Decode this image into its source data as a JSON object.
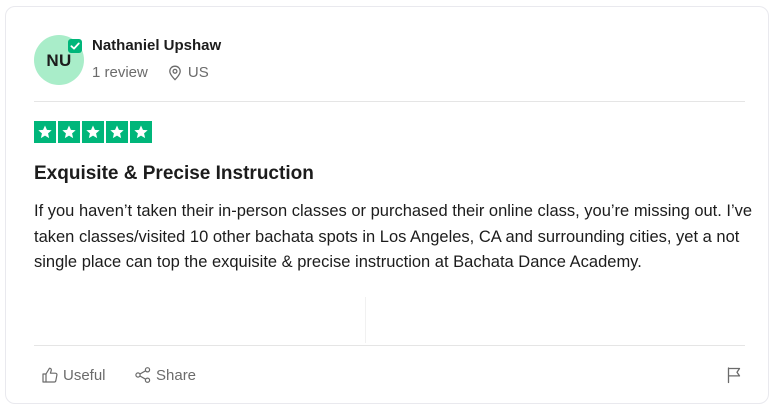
{
  "reviewer": {
    "initials": "NU",
    "name": "Nathaniel Upshaw",
    "review_count": "1 review",
    "location": "US",
    "avatar_color": "#a9edc9",
    "verified_color": "#00b67a"
  },
  "rating": {
    "stars": 5,
    "max": 5,
    "star_color": "#00b67a"
  },
  "review": {
    "title": "Exquisite & Precise Instruction",
    "body": "If you haven’t taken their in-person classes or purchased their online class, you’re missing out. I’ve taken classes/visited 10 other bachata spots in Los Angeles, CA and surrounding cities, yet a not single place can top the exquisite & precise instruction at Bachata Dance Academy."
  },
  "actions": {
    "useful_label": "Useful",
    "useful_icon": "thumbs-up-icon",
    "share_label": "Share",
    "share_icon": "share-icon",
    "report_icon": "flag-icon"
  }
}
